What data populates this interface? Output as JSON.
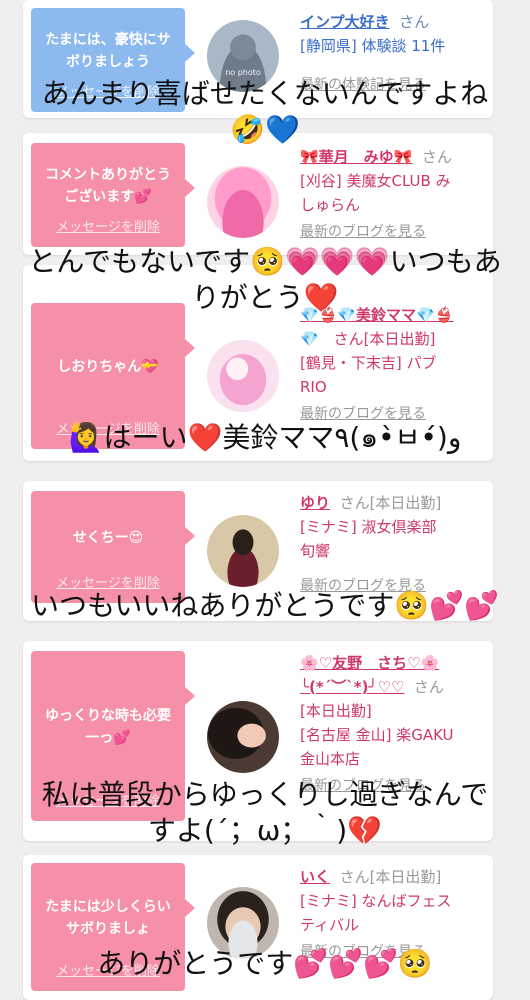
{
  "cards": [
    {
      "message": "たまには、豪快にサボりましょう",
      "delete_label": "メッセージを削除",
      "name": "インプ大好き",
      "san": "さん",
      "lines": [
        "[静岡県] 体験談 11件"
      ],
      "blog_link": "最新の体験記を見る",
      "avatar_text": "no photo",
      "caption": [
        "あんまり喜ばせたくないんですよね",
        "🤣💙"
      ]
    },
    {
      "message": "コメントありがとうございます💕",
      "delete_label": "メッセージを削除",
      "name": "🎀華月　みゆ🎀",
      "san": "さん",
      "lines": [
        "[刈谷] 美魔女CLUB み",
        "しゅらん"
      ],
      "blog_link": "最新のブログを見る",
      "caption": [
        "とんでもないです🥺💗💗💗いつもあ",
        "りがとう❤️"
      ]
    },
    {
      "message": "しおりちゃん💝",
      "delete_label": "メッセージを削除",
      "name": "💎👙💎美鈴ママ💎👙",
      "san": "💎　さん[本日出勤]",
      "lines": [
        "[鶴見・下末吉] パブ",
        "RIO"
      ],
      "blog_link": "最新のブログを見る",
      "caption": [
        "🙋‍♀️はーい❤️美鈴ママ٩(๑•̀ㅂ•́)و"
      ]
    },
    {
      "message": "せくちー😍",
      "delete_label": "メッセージを削除",
      "name": "ゆり",
      "san": "さん[本日出勤]",
      "lines": [
        "[ミナミ] 淑女倶楽部",
        "旬響"
      ],
      "blog_link": "最新のブログを見る",
      "caption": [
        "いつもいいねありがとうです🥺💕💕"
      ]
    },
    {
      "message": "ゆっくりな時も必要一っ💕",
      "delete_label": "メッセージを削除",
      "name": "🌸♡友野　さち♡🌸",
      "name2": "╰(*´︶`*)╯♡♡",
      "san": "さん",
      "lines": [
        "[本日出勤]",
        "[名古屋 金山] 楽GAKU",
        "金山本店"
      ],
      "blog_link": "最新のブログを見る",
      "caption": [
        "私は普段からゆっくりし過ぎなんで",
        "すよ(´；ω；｀)💔"
      ]
    },
    {
      "message": "たまには少しくらいサボりましょ",
      "delete_label": "メッセージを削除",
      "name": "いく",
      "san": "さん[本日出勤]",
      "lines": [
        "[ミナミ] なんばフェス",
        "ティバル"
      ],
      "blog_link": "最新のブログを見る",
      "caption": [
        "ありがとうです💕💕💕🥺"
      ]
    }
  ]
}
